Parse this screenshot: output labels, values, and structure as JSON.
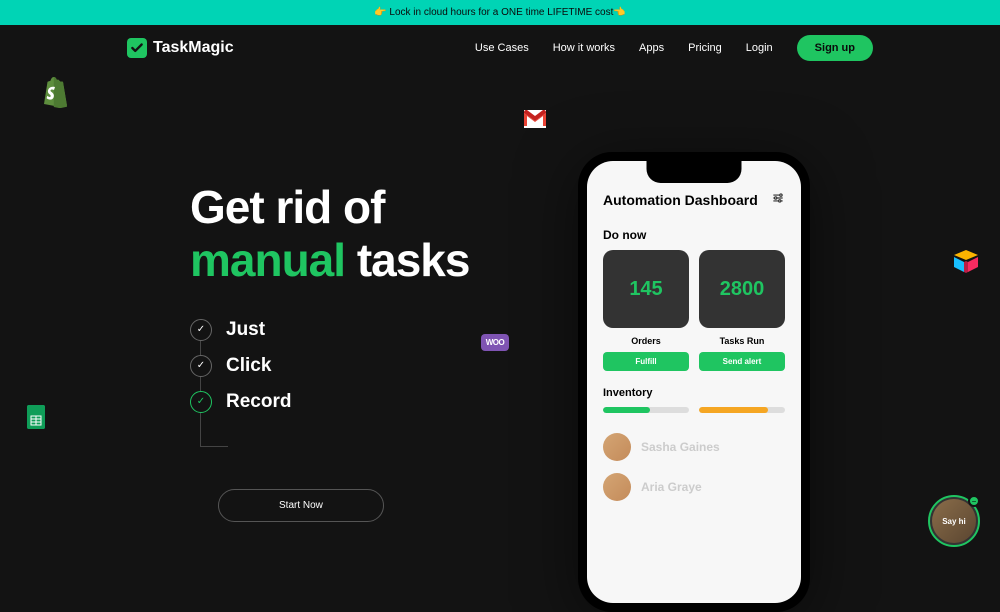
{
  "promo": {
    "text": "👉 Lock in cloud hours for a ONE time LIFETIME cost👈"
  },
  "brand": {
    "name": "TaskMagic"
  },
  "nav": {
    "use_cases": "Use Cases",
    "how_it_works": "How it works",
    "apps": "Apps",
    "pricing": "Pricing",
    "login": "Login",
    "signup": "Sign up"
  },
  "hero": {
    "line1": "Get rid of",
    "accent": "manual",
    "line2_rest": " tasks",
    "steps": [
      "Just",
      "Click",
      "Record"
    ],
    "cta": "Start Now"
  },
  "phone": {
    "title": "Automation Dashboard",
    "section1": "Do now",
    "card1_value": "145",
    "card2_value": "2800",
    "card1_label": "Orders",
    "card2_label": "Tasks Run",
    "card1_btn": "Fulfill",
    "card2_btn": "Send alert",
    "inventory": "Inventory",
    "person1": "Sasha Gaines",
    "person2": "Aria Graye"
  },
  "chat": {
    "label": "Say hi"
  },
  "icons": {
    "shopify": "shopify-icon",
    "gmail": "gmail-icon",
    "woo": "woo-icon",
    "sheets": "sheets-icon",
    "airtable": "airtable-icon"
  }
}
